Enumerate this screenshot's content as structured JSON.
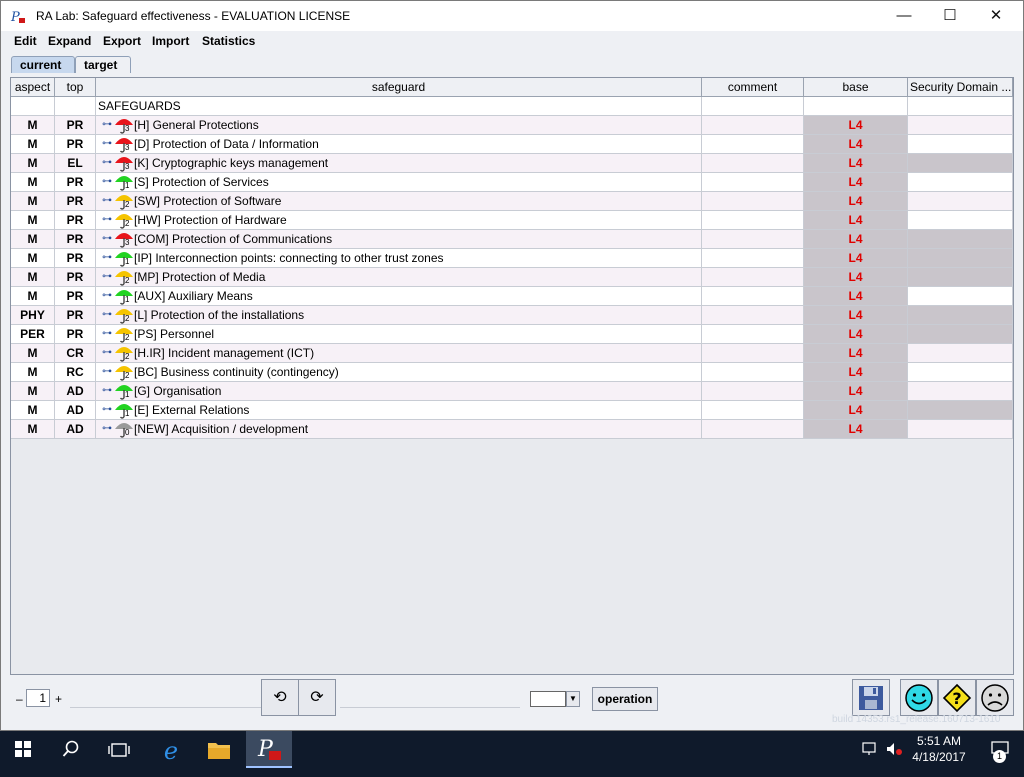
{
  "window": {
    "title": "RA Lab: Safeguard effectiveness - EVALUATION LICENSE",
    "minimize": "—",
    "maximize": "☐",
    "close": "✕"
  },
  "menu": [
    "Edit",
    "Expand",
    "Export",
    "Import",
    "Statistics"
  ],
  "tabs": [
    {
      "label": "current",
      "active": true
    },
    {
      "label": "target",
      "active": false
    }
  ],
  "columns": {
    "aspect": "aspect",
    "top": "top",
    "safeguard": "safeguard",
    "comment": "comment",
    "base": "base",
    "security_domain": "Security Domain ..."
  },
  "root_row": {
    "label": "SAFEGUARDS"
  },
  "rows": [
    {
      "aspect": "M",
      "top": "PR",
      "label": "[H] General Protections",
      "umbrella": "red",
      "level": "3",
      "base": "L4",
      "sd_grey": false
    },
    {
      "aspect": "M",
      "top": "PR",
      "label": "[D] Protection of Data / Information",
      "umbrella": "red",
      "level": "3",
      "base": "L4",
      "sd_grey": false
    },
    {
      "aspect": "M",
      "top": "EL",
      "label": "[K] Cryptographic keys management",
      "umbrella": "red",
      "level": "3",
      "base": "L4",
      "sd_grey": true
    },
    {
      "aspect": "M",
      "top": "PR",
      "label": "[S] Protection of Services",
      "umbrella": "green",
      "level": "1",
      "base": "L4",
      "sd_grey": false
    },
    {
      "aspect": "M",
      "top": "PR",
      "label": "[SW] Protection of Software",
      "umbrella": "yellow",
      "level": "2",
      "base": "L4",
      "sd_grey": false
    },
    {
      "aspect": "M",
      "top": "PR",
      "label": "[HW] Protection of Hardware",
      "umbrella": "yellow",
      "level": "2",
      "base": "L4",
      "sd_grey": false
    },
    {
      "aspect": "M",
      "top": "PR",
      "label": "[COM] Protection of Communications",
      "umbrella": "red",
      "level": "3",
      "base": "L4",
      "sd_grey": true
    },
    {
      "aspect": "M",
      "top": "PR",
      "label": "[IP] Interconnection points: connecting to other trust zones",
      "umbrella": "green",
      "level": "1",
      "base": "L4",
      "sd_grey": true
    },
    {
      "aspect": "M",
      "top": "PR",
      "label": "[MP] Protection of Media",
      "umbrella": "yellow",
      "level": "2",
      "base": "L4",
      "sd_grey": true
    },
    {
      "aspect": "M",
      "top": "PR",
      "label": "[AUX] Auxiliary Means",
      "umbrella": "green",
      "level": "1",
      "base": "L4",
      "sd_grey": false
    },
    {
      "aspect": "PHY",
      "top": "PR",
      "label": "[L] Protection of the installations",
      "umbrella": "yellow",
      "level": "2",
      "base": "L4",
      "sd_grey": true
    },
    {
      "aspect": "PER",
      "top": "PR",
      "label": "[PS] Personnel",
      "umbrella": "yellow",
      "level": "2",
      "base": "L4",
      "sd_grey": true
    },
    {
      "aspect": "M",
      "top": "CR",
      "label": "[H.IR] Incident management (ICT)",
      "umbrella": "yellow",
      "level": "2",
      "base": "L4",
      "sd_grey": false
    },
    {
      "aspect": "M",
      "top": "RC",
      "label": "[BC] Business continuity (contingency)",
      "umbrella": "yellow",
      "level": "2",
      "base": "L4",
      "sd_grey": false
    },
    {
      "aspect": "M",
      "top": "AD",
      "label": "[G] Organisation",
      "umbrella": "green",
      "level": "1",
      "base": "L4",
      "sd_grey": false
    },
    {
      "aspect": "M",
      "top": "AD",
      "label": "[E] External Relations",
      "umbrella": "green",
      "level": "1",
      "base": "L4",
      "sd_grey": true
    },
    {
      "aspect": "M",
      "top": "AD",
      "label": "[NEW] Acquisition / development",
      "umbrella": "grey",
      "level": "0",
      "base": "L4",
      "sd_grey": false
    }
  ],
  "colors": {
    "red": "#e8141b",
    "green": "#22d322",
    "yellow": "#f5c400",
    "grey": "#9a9a9a"
  },
  "bottom": {
    "minus": "–",
    "level_value": "1",
    "plus": "+",
    "undo": "⟲",
    "redo": "⟳",
    "operation": "operation",
    "dropdown_value": ""
  },
  "build_text": "build 14353.rs1_release.160713-1610",
  "taskbar": {
    "time": "5:51 AM",
    "date": "4/18/2017",
    "notifications": "1"
  }
}
